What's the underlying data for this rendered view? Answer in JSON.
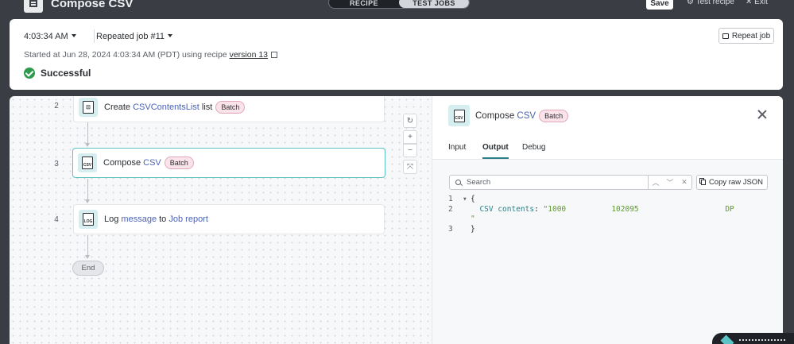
{
  "topbar": {
    "app_title": "Compose CSV",
    "segments": [
      "RECIPE",
      "TEST JOBS"
    ],
    "save_label": "Save",
    "test_recipe_label": "Test recipe",
    "exit_label": "Exit"
  },
  "job": {
    "time": "4:03:34 AM",
    "job_name": "Repeated job #11",
    "started_prefix": "Started at Jun 28, 2024 4:03:34 AM (PDT) using recipe",
    "version_link": "version 13",
    "status": "Successful",
    "repeat_label": "Repeat job"
  },
  "steps": [
    {
      "num": "2",
      "action": "Create",
      "link": "CSVContentsList",
      "suffix": "list",
      "badge": "Batch",
      "icon_text": ""
    },
    {
      "num": "3",
      "action": "Compose",
      "link": "CSV",
      "suffix": "",
      "badge": "Batch",
      "icon_text": "CSV"
    },
    {
      "num": "4",
      "action": "Log",
      "link": "message",
      "mid": "to",
      "link2": "Job report",
      "icon_text": "LOG"
    }
  ],
  "end_label": "End",
  "zoom_controls": [
    "↻",
    "+",
    "−",
    "⤧"
  ],
  "panel": {
    "title_prefix": "Compose",
    "title_link": "CSV",
    "badge": "Batch",
    "icon_text": "CSV",
    "tabs": [
      "Input",
      "Output",
      "Debug"
    ],
    "active_tab": "Output",
    "search_placeholder": "Search",
    "copy_label": "Copy raw JSON",
    "code": {
      "line1_num": "1",
      "line1_text": "{",
      "line2_num": "2",
      "line2_key": "CSV contents",
      "line2_value": "\"1000          102095                   DP",
      "line2_cont": "\"",
      "line3_num": "3",
      "line3_text": "}"
    }
  },
  "colors": {
    "accent": "#5cc3c4",
    "link": "#4b62b5",
    "success": "#2f9a4c",
    "badge_bg": "#fbe3ea"
  }
}
